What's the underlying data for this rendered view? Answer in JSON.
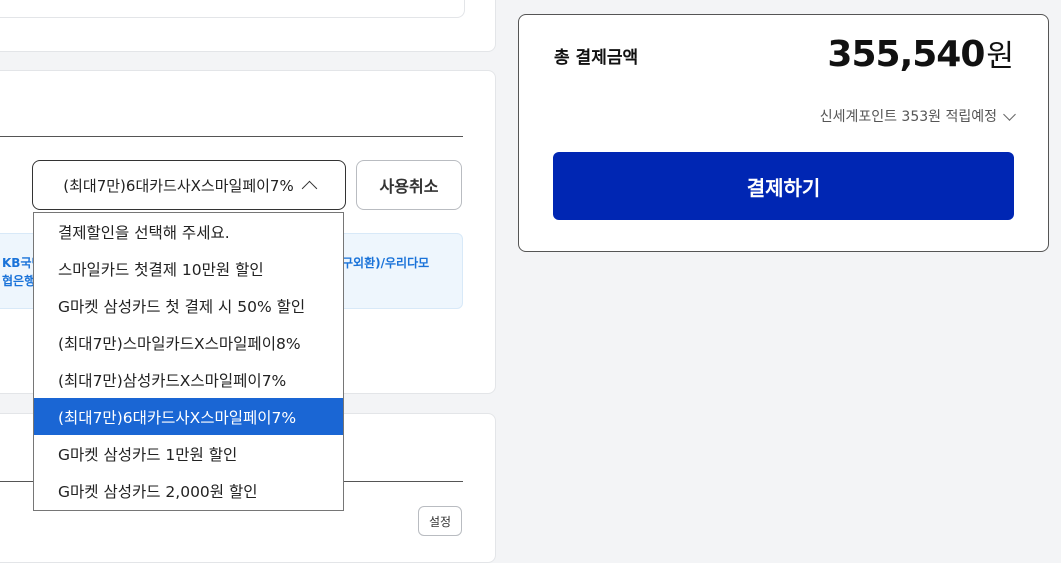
{
  "discount": {
    "selected_label": "(최대7만)6대카드사X스마일페이7%",
    "cancel_label": "사용취소",
    "info_left_line1": "KB국민",
    "info_right_line1": "구외환)/우리다모",
    "info_left_line2": "협은행",
    "options": [
      "결제할인을 선택해 주세요.",
      "스마일카드 첫결제 10만원 할인",
      "G마켓 삼성카드 첫 결제 시 50% 할인",
      "(최대7만)스마일카드X스마일페이8%",
      "(최대7만)삼성카드X스마일페이7%",
      "(최대7만)6대카드사X스마일페이7%",
      "G마켓 삼성카드 1만원 할인",
      "G마켓 삼성카드 2,000원 할인"
    ],
    "selected_index": 5
  },
  "bottom": {
    "setting_label": "설정"
  },
  "summary": {
    "total_label": "총 결제금액",
    "total_amount": "355,540",
    "total_unit": "원",
    "points_text": "신세계포인트 353원 적립예정",
    "pay_label": "결제하기"
  },
  "colors": {
    "accent": "#0026b3",
    "selected_option": "#1a66d4",
    "info_text": "#1a73d9"
  }
}
